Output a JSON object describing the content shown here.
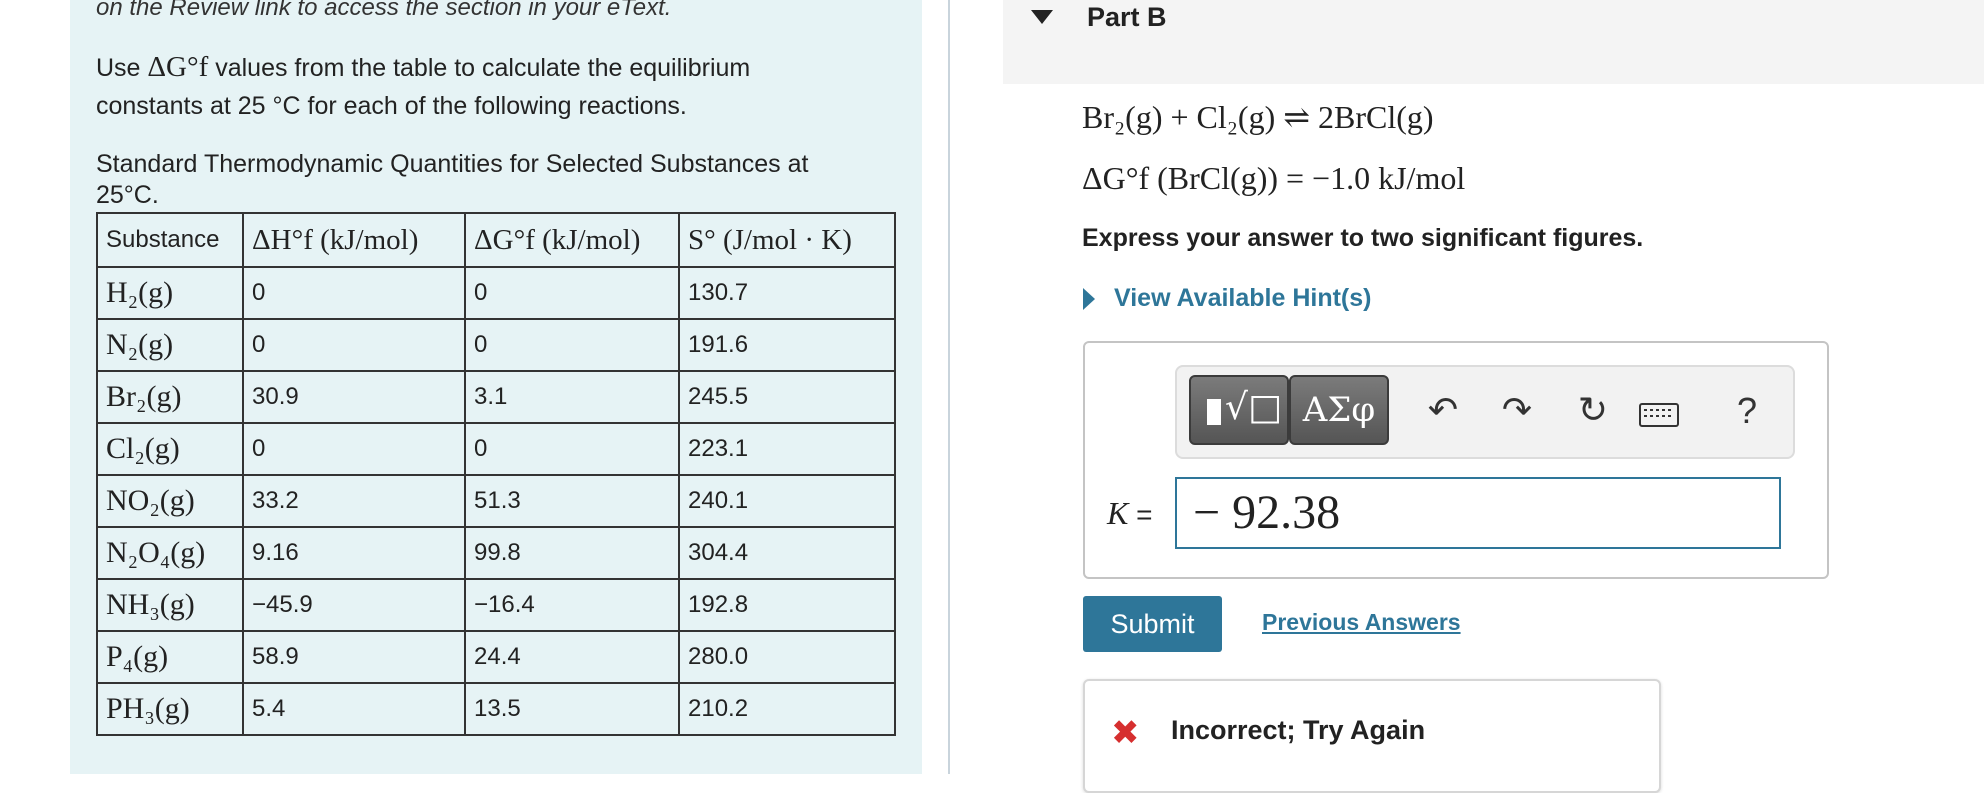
{
  "left": {
    "intro_line": "on the Review link to access the section in your eText.",
    "task_part1": "Use ",
    "task_symbol": "ΔG°f",
    "task_part2": " values from the table to calculate the equilibrium constants at 25 °C for each of the following reactions.",
    "table_caption": "Standard Thermodynamic Quantities for Selected Substances at 25°C.",
    "table": {
      "headers": [
        "Substance",
        "ΔH°f (kJ/mol)",
        "ΔG°f (kJ/mol)",
        "S° (J/mol · K)"
      ],
      "rows": [
        [
          "H₂(g)",
          "0",
          "0",
          "130.7"
        ],
        [
          "N₂(g)",
          "0",
          "0",
          "191.6"
        ],
        [
          "Br₂(g)",
          "30.9",
          "3.1",
          "245.5"
        ],
        [
          "Cl₂(g)",
          "0",
          "0",
          "223.1"
        ],
        [
          "NO₂(g)",
          "33.2",
          "51.3",
          "240.1"
        ],
        [
          "N₂O₄(g)",
          "9.16",
          "99.8",
          "304.4"
        ],
        [
          "NH₃(g)",
          "−45.9",
          "−16.4",
          "192.8"
        ],
        [
          "P₄(g)",
          "58.9",
          "24.4",
          "280.0"
        ],
        [
          "PH₃(g)",
          "5.4",
          "13.5",
          "210.2"
        ]
      ]
    }
  },
  "right": {
    "part_title": "Part B",
    "reaction": "Br₂(g) + Cl₂(g) ⇌ 2BrCl(g)",
    "gibbs": "ΔG°f (BrCl(g)) = −1.0 kJ/mol",
    "instruction": "Express your answer to two significant figures.",
    "hint_link": "View Available Hint(s)",
    "toolbar": {
      "symbols_label": "ΑΣφ",
      "help_label": "?"
    },
    "answer_label": "K",
    "answer_equals": " =",
    "answer_value": "− 92.38",
    "submit_label": "Submit",
    "previous_answers_label": "Previous Answers",
    "feedback_text": "Incorrect; Try Again"
  }
}
